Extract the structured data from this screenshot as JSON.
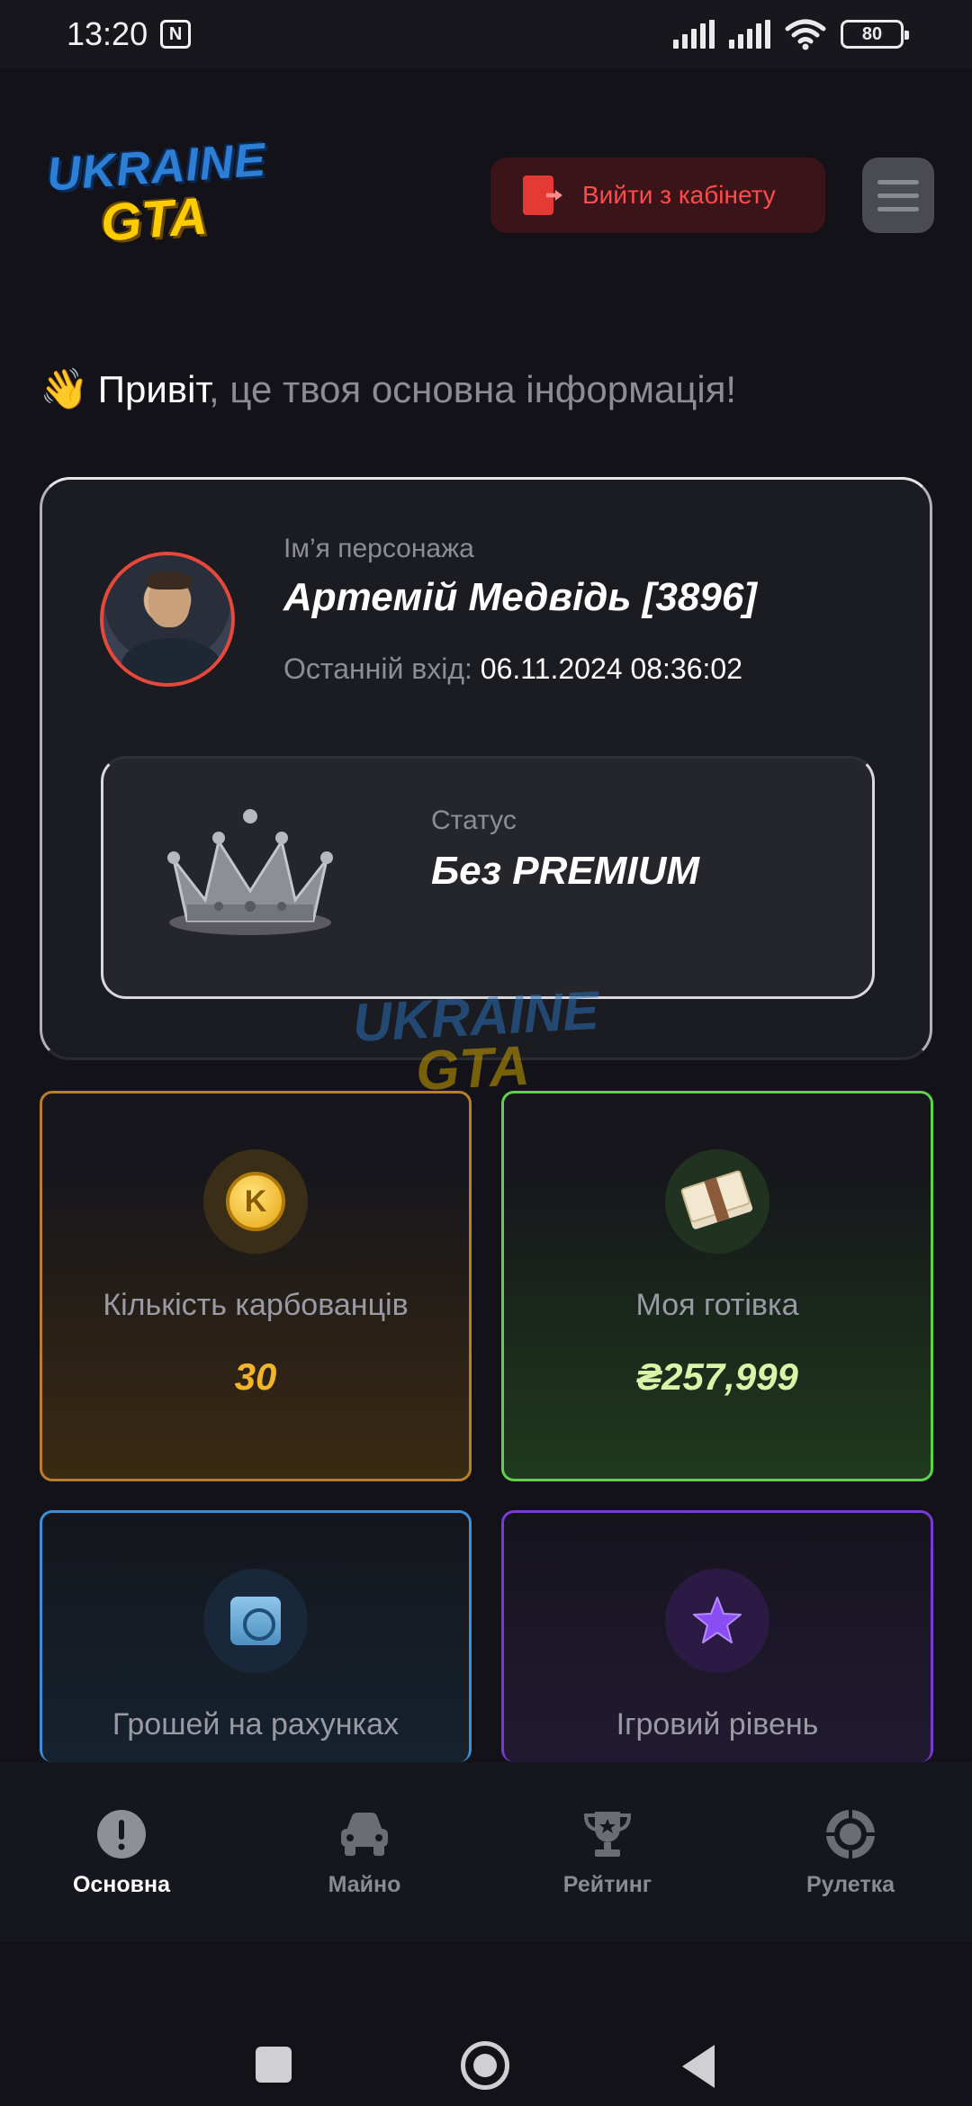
{
  "status_bar": {
    "time": "13:20",
    "battery": "80",
    "icons": [
      "nfc-icon",
      "signal-icon",
      "signal-icon",
      "wifi-icon",
      "battery-icon"
    ]
  },
  "header": {
    "logo_line1": "UKRAINE",
    "logo_line2": "GTA",
    "logout_label": "Вийти з кабінету",
    "menu_icon": "hamburger-icon"
  },
  "greeting": {
    "emoji": "👋",
    "hello": "Привіт",
    "rest": ", це твоя основна інформація!"
  },
  "profile": {
    "name_label": "Ім’я персонажа",
    "name": "Артемій Медвідь [3896]",
    "last_login_label": "Останній вхід:",
    "last_login_value": "06.11.2024 08:36:02",
    "status_label": "Статус",
    "status_value": "Без PREMIUM"
  },
  "watermark": {
    "line1": "UKRAINE",
    "line2": "GTA"
  },
  "cards": {
    "coins": {
      "title": "Кількість карбованців",
      "value": "30",
      "coin_letter": "K"
    },
    "cash": {
      "title": "Моя готівка",
      "value": "₴257,999"
    },
    "bank": {
      "title": "Грошей на рахунках"
    },
    "level": {
      "title": "Ігровий рівень"
    }
  },
  "bottom_nav": {
    "items": [
      {
        "label": "Основна",
        "icon": "info-icon",
        "active": true
      },
      {
        "label": "Майно",
        "icon": "car-icon",
        "active": false
      },
      {
        "label": "Рейтинг",
        "icon": "trophy-icon",
        "active": false
      },
      {
        "label": "Рулетка",
        "icon": "roulette-icon",
        "active": false
      }
    ]
  },
  "colors": {
    "background": "#121218",
    "logout_text": "#ff4b4b",
    "coins_accent": "#f2b42a",
    "cash_accent": "#5fd14a",
    "bank_accent": "#3a8fd6",
    "level_accent": "#7b3ad6"
  }
}
